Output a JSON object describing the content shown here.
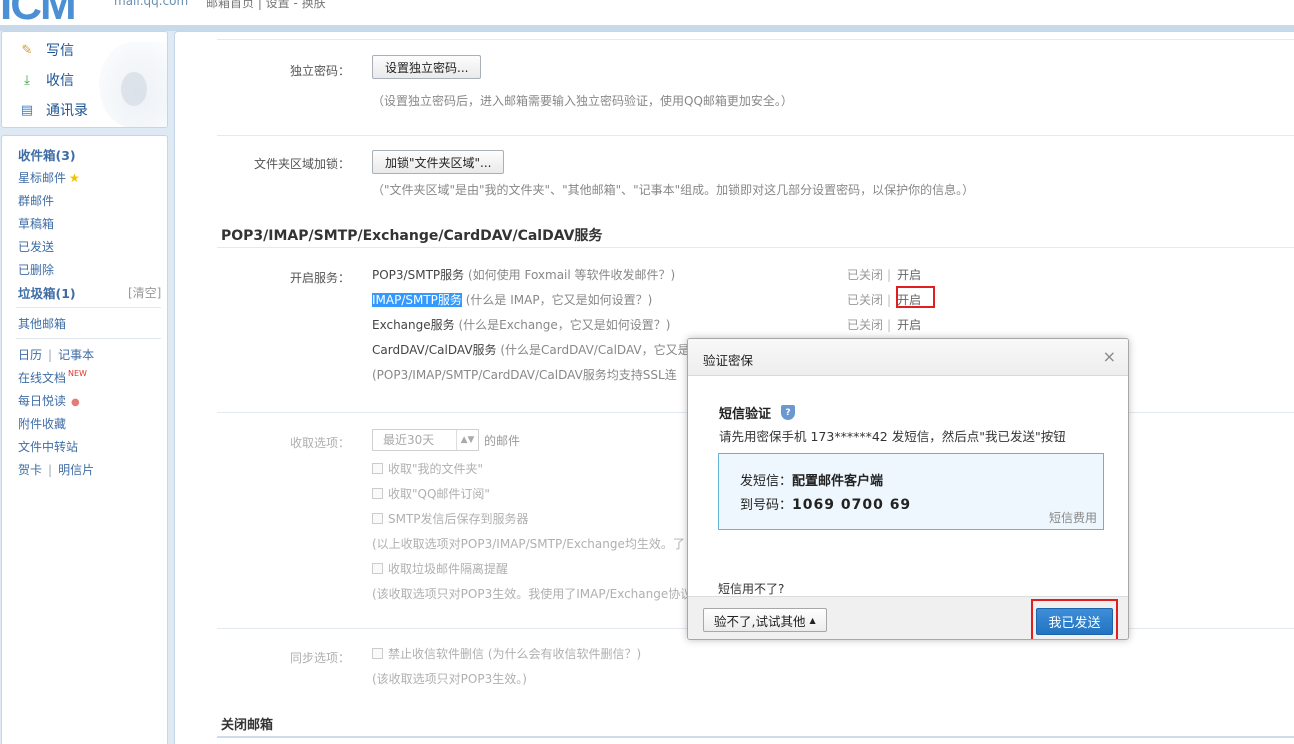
{
  "header": {
    "logo_text": "ICM",
    "logo_url": "mail.qq.com",
    "links": "邮箱首页 | 设置 - 换肤"
  },
  "sidebar": {
    "tools": [
      {
        "label": "写信",
        "icon": "write-icon"
      },
      {
        "label": "收信",
        "icon": "inbox-download-icon"
      },
      {
        "label": "通讯录",
        "icon": "contacts-icon"
      }
    ],
    "inbox": "收件箱(3)",
    "starred": "星标邮件",
    "group": "群邮件",
    "drafts": "草稿箱",
    "sent": "已发送",
    "deleted": "已删除",
    "junk": "垃圾箱(1)",
    "junk_clear": "[清空]",
    "other": "其他邮箱",
    "calendar": "日历",
    "notes": "记事本",
    "docs": "在线文档",
    "docs_new": "NEW",
    "daily": "每日悦读",
    "attachments": "附件收藏",
    "transfer": "文件中转站",
    "cards": "贺卡",
    "postcards": "明信片"
  },
  "settings": {
    "pwd_label": "独立密码：",
    "pwd_button": "设置独立密码...",
    "pwd_hint": "（设置独立密码后，进入邮箱需要输入独立密码验证，使用QQ邮箱更加安全。）",
    "folder_label": "文件夹区域加锁：",
    "folder_button": "加锁\"文件夹区域\"...",
    "folder_hint": "（\"文件夹区域\"是由\"我的文件夹\"、\"其他邮箱\"、\"记事本\"组成。加锁即对这几部分设置密码，以保护你的信息。）",
    "section_title": "POP3/IMAP/SMTP/Exchange/CardDAV/CalDAV服务",
    "service_label": "开启服务：",
    "services": [
      {
        "name": "POP3/SMTP服务",
        "help": "(如何使用 Foxmail 等软件收发邮件？)",
        "status": "已关闭",
        "action": "开启"
      },
      {
        "name": "IMAP/SMTP服务",
        "help": "(什么是 IMAP，它又是如何设置？)",
        "status": "已关闭",
        "action": "开启"
      },
      {
        "name": "Exchange服务",
        "help": "(什么是Exchange，它又是如何设置？)",
        "status": "已关闭",
        "action": "开启"
      },
      {
        "name": "CardDAV/CalDAV服务",
        "help": "(什么是CardDAV/CalDAV，它又是",
        "status": "",
        "action": ""
      }
    ],
    "ssl_hint": "(POP3/IMAP/SMTP/CardDAV/CalDAV服务均支持SSL连",
    "receive_label": "收取选项：",
    "receive_select": "最近30天",
    "receive_suffix": "的邮件",
    "opt1": "收取\"我的文件夹\"",
    "opt2": "收取\"QQ邮件订阅\"",
    "opt3": "SMTP发信后保存到服务器",
    "opt_hint1": "(以上收取选项对POP3/IMAP/SMTP/Exchange均生效。了",
    "opt4": "收取垃圾邮件隔离提醒",
    "opt_hint2": "(该收取选项只对POP3生效。我使用了IMAP/Exchange协议",
    "sync_label": "同步选项：",
    "sync_opt": "禁止收信软件删信",
    "sync_help": "(为什么会有收信软件删信？)",
    "sync_hint": "(该收取选项只对POP3生效。)",
    "close_title": "关闭邮箱"
  },
  "dialog": {
    "title": "验证密保",
    "close": "×",
    "sms_title": "短信验证",
    "desc": "请先用密保手机 173******42 发短信，然后点\"我已发送\"按钮",
    "send_label": "发短信：",
    "send_content": "配置邮件客户端",
    "to_label": "到号码：",
    "to_number": "1069 0700 69",
    "fee": "短信费用",
    "cant_use": "短信用不了?",
    "alt_button": "验不了,试试其他",
    "sent_button": "我已发送"
  }
}
